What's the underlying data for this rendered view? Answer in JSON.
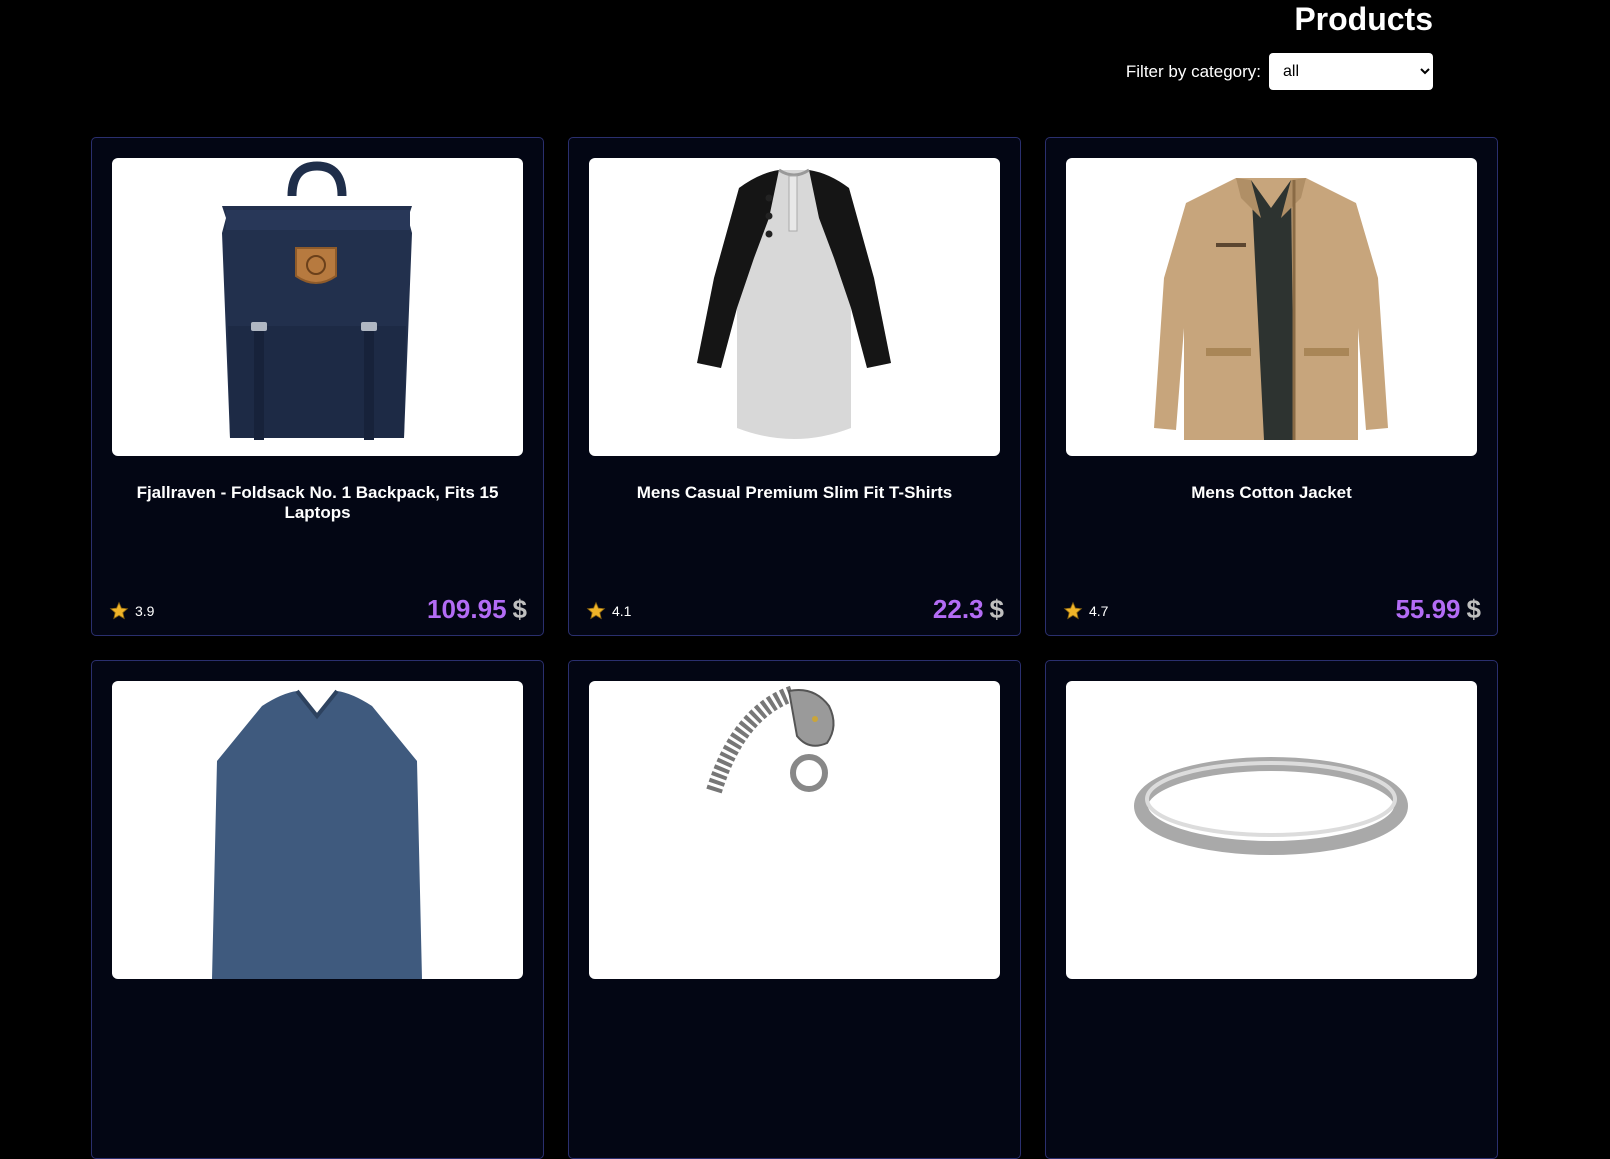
{
  "header": {
    "title": "Products",
    "filter_label": "Filter by category:",
    "filter_selected": "all"
  },
  "products": [
    {
      "title": "Fjallraven - Foldsack No. 1 Backpack, Fits 15 Laptops",
      "rating": "3.9",
      "price": "109.95",
      "currency": "$",
      "image": "backpack"
    },
    {
      "title": "Mens Casual Premium Slim Fit T-Shirts",
      "rating": "4.1",
      "price": "22.3",
      "currency": "$",
      "image": "raglan-tshirt"
    },
    {
      "title": "Mens Cotton Jacket",
      "rating": "4.7",
      "price": "55.99",
      "currency": "$",
      "image": "khaki-jacket"
    },
    {
      "title": "",
      "rating": "",
      "price": "",
      "currency": "",
      "image": "blue-vneck-shirt"
    },
    {
      "title": "",
      "rating": "",
      "price": "",
      "currency": "",
      "image": "dragon-bracelet"
    },
    {
      "title": "",
      "rating": "",
      "price": "",
      "currency": "",
      "image": "silver-ring"
    }
  ],
  "colors": {
    "background": "#000000",
    "card_border": "#2a2f6e",
    "price": "#b36cf5",
    "star": "#f0b429"
  }
}
